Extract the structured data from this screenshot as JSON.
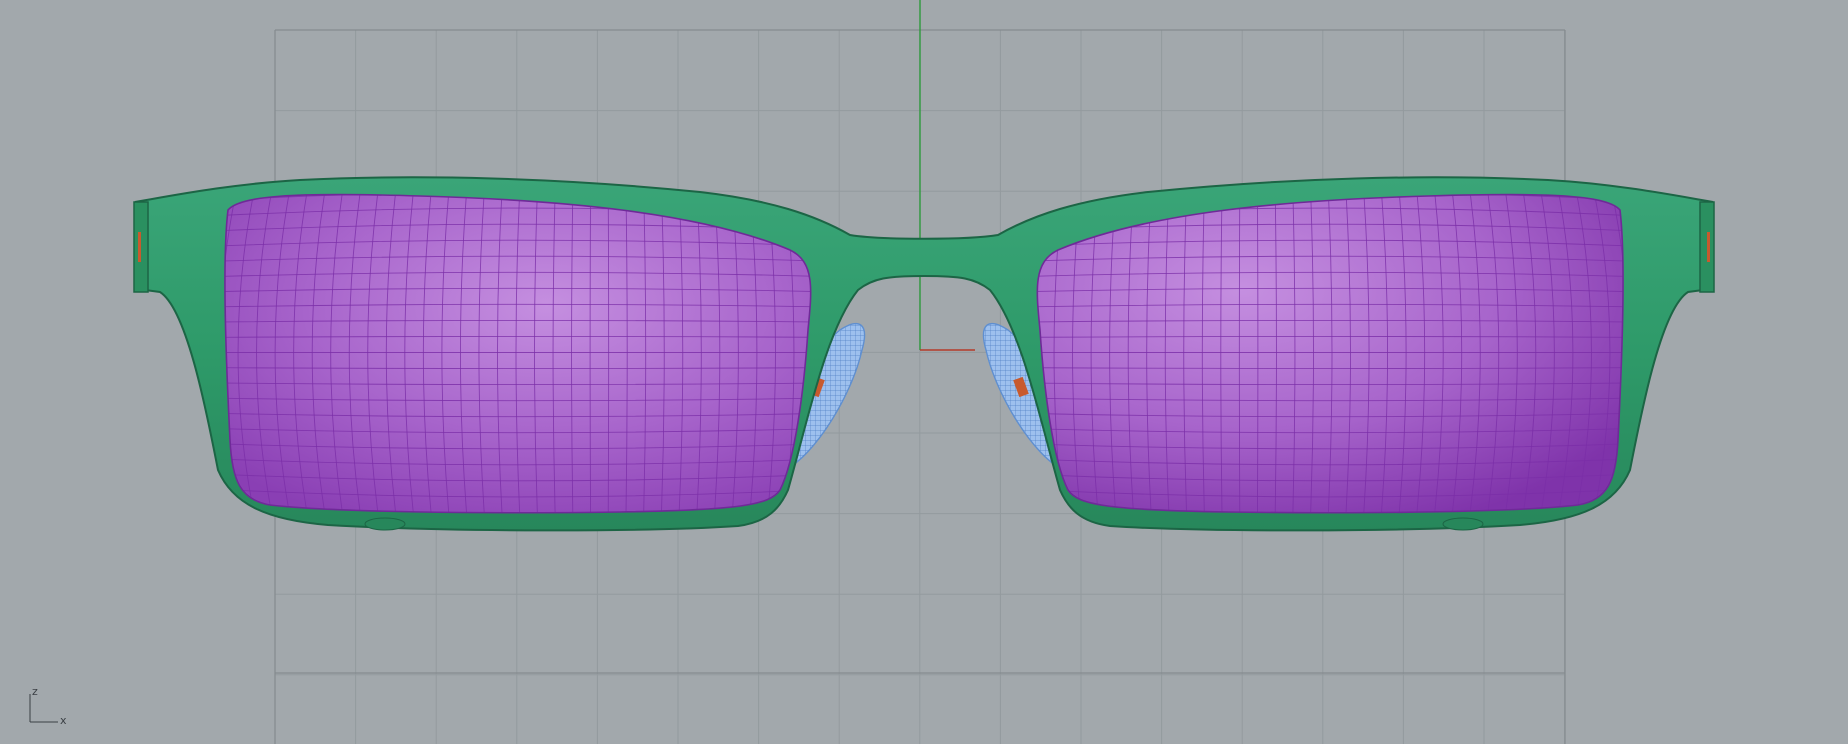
{
  "viewport": {
    "view": "Front",
    "background_color": "#a2a8ac",
    "grid": "on",
    "grid_color": "#8f9599",
    "grid_major_color": "#7e8488",
    "y_axis_color": "#2e9a3c",
    "x_axis_color": "#b43a2a"
  },
  "model": {
    "object": "eyeglasses",
    "frame_color": "#2f9a6a",
    "frame_wire_color": "#1f6e4b",
    "lens_color": "#a25ec8",
    "lens_wire_color": "#7b2ea8",
    "nose_pad_color": "#8fb6ea",
    "nose_pad_wire_color": "#5f8fd0",
    "hinge_accent_color": "#c85a2e"
  },
  "axis_widget": {
    "z_label": "z",
    "x_label": "x"
  }
}
